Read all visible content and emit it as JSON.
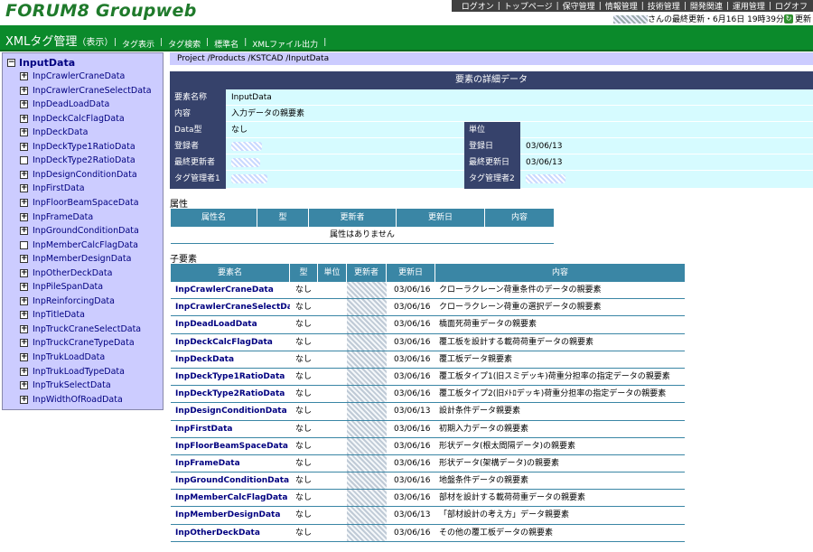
{
  "header": {
    "logo": "FORUM8 Groupweb",
    "nav": [
      "ログオン",
      "トップページ",
      "保守管理",
      "情報管理",
      "技術管理",
      "開発関連",
      "運用管理",
      "ログオフ"
    ],
    "last_update": "さんの最終更新・6月16日 19時39分",
    "refresh_label": "更新"
  },
  "greenbar": {
    "title": "XMLタグ管理",
    "subtitle": "（表示）",
    "links": [
      "タグ表示",
      "タグ検索",
      "標準名",
      "XMLファイル出力"
    ]
  },
  "sidebar": {
    "root": "InputData",
    "items": [
      {
        "label": "InpCrawlerCraneData",
        "expander": "+"
      },
      {
        "label": "InpCrawlerCraneSelectData",
        "expander": "+"
      },
      {
        "label": "InpDeadLoadData",
        "expander": "+"
      },
      {
        "label": "InpDeckCalcFlagData",
        "expander": "+"
      },
      {
        "label": "InpDeckData",
        "expander": "+"
      },
      {
        "label": "InpDeckType1RatioData",
        "expander": "+"
      },
      {
        "label": "InpDeckType2RatioData",
        "expander": " "
      },
      {
        "label": "InpDesignConditionData",
        "expander": "+"
      },
      {
        "label": "InpFirstData",
        "expander": "+"
      },
      {
        "label": "InpFloorBeamSpaceData",
        "expander": "+"
      },
      {
        "label": "InpFrameData",
        "expander": "+"
      },
      {
        "label": "InpGroundConditionData",
        "expander": "+"
      },
      {
        "label": "InpMemberCalcFlagData",
        "expander": " "
      },
      {
        "label": "InpMemberDesignData",
        "expander": "+"
      },
      {
        "label": "InpOtherDeckData",
        "expander": "+"
      },
      {
        "label": "InpPileSpanData",
        "expander": "+"
      },
      {
        "label": "InpReinforcingData",
        "expander": "+"
      },
      {
        "label": "InpTitleData",
        "expander": "+"
      },
      {
        "label": "InpTruckCraneSelectData",
        "expander": "+"
      },
      {
        "label": "InpTruckCraneTypeData",
        "expander": "+"
      },
      {
        "label": "InpTrukLoadData",
        "expander": "+"
      },
      {
        "label": "InpTrukLoadTypeData",
        "expander": "+"
      },
      {
        "label": "InpTrukSelectData",
        "expander": "+"
      },
      {
        "label": "InpWidthOfRoadData",
        "expander": "+"
      }
    ]
  },
  "breadcrumb": "Project /Products /KSTCAD /InputData",
  "detail": {
    "heading": "要素の詳細データ",
    "element_name_label": "要素名称",
    "element_name": "InputData",
    "content_label": "内容",
    "content": "入力データの親要素",
    "data_type_label": "Data型",
    "data_type": "なし",
    "unit_label": "単位",
    "unit": "",
    "registrant_label": "登録者",
    "registered_date_label": "登録日",
    "registered_date": "03/06/13",
    "last_updater_label": "最終更新者",
    "last_update_date_label": "最終更新日",
    "last_update_date": "03/06/13",
    "tag_manager1_label": "タグ管理者1",
    "tag_manager2_label": "タグ管理者2"
  },
  "attributes": {
    "section_title": "属性",
    "headers": [
      "属性名",
      "型",
      "更新者",
      "更新日",
      "内容"
    ],
    "empty_message": "属性はありません"
  },
  "children": {
    "section_title": "子要素",
    "headers": [
      "要素名",
      "型",
      "単位",
      "更新者",
      "更新日",
      "内容"
    ],
    "rows": [
      {
        "name": "InpCrawlerCraneData",
        "type": "なし",
        "date": "03/06/16",
        "desc": "クローラクレーン荷重条件のデータの親要素"
      },
      {
        "name": "InpCrawlerCraneSelectData",
        "type": "なし",
        "date": "03/06/16",
        "desc": "クローラクレーン荷重の選択データの親要素"
      },
      {
        "name": "InpDeadLoadData",
        "type": "なし",
        "date": "03/06/16",
        "desc": "橋面死荷重データの親要素"
      },
      {
        "name": "InpDeckCalcFlagData",
        "type": "なし",
        "date": "03/06/16",
        "desc": "覆工板を設計する載荷荷重データの親要素"
      },
      {
        "name": "InpDeckData",
        "type": "なし",
        "date": "03/06/16",
        "desc": "覆工板データ親要素"
      },
      {
        "name": "InpDeckType1RatioData",
        "type": "なし",
        "date": "03/06/16",
        "desc": "覆工板タイプ1(旧スミデッキ)荷重分担率の指定データの親要素"
      },
      {
        "name": "InpDeckType2RatioData",
        "type": "なし",
        "date": "03/06/16",
        "desc": "覆工板タイプ2(旧ﾒﾄﾛデッキ)荷重分担率の指定データの親要素"
      },
      {
        "name": "InpDesignConditionData",
        "type": "なし",
        "date": "03/06/13",
        "desc": "設計条件データ親要素"
      },
      {
        "name": "InpFirstData",
        "type": "なし",
        "date": "03/06/16",
        "desc": "初期入力データの親要素"
      },
      {
        "name": "InpFloorBeamSpaceData",
        "type": "なし",
        "date": "03/06/16",
        "desc": "形状データ(根太間隔データ)の親要素"
      },
      {
        "name": "InpFrameData",
        "type": "なし",
        "date": "03/06/16",
        "desc": "形状データ(架構データ)の親要素"
      },
      {
        "name": "InpGroundConditionData",
        "type": "なし",
        "date": "03/06/16",
        "desc": "地盤条件データの親要素"
      },
      {
        "name": "InpMemberCalcFlagData",
        "type": "なし",
        "date": "03/06/16",
        "desc": "部材を設計する載荷荷重データの親要素"
      },
      {
        "name": "InpMemberDesignData",
        "type": "なし",
        "date": "03/06/13",
        "desc": "「部材設計の考え方」データ親要素"
      },
      {
        "name": "InpOtherDeckData",
        "type": "なし",
        "date": "03/06/16",
        "desc": "その他の覆工板データの親要素"
      }
    ]
  }
}
